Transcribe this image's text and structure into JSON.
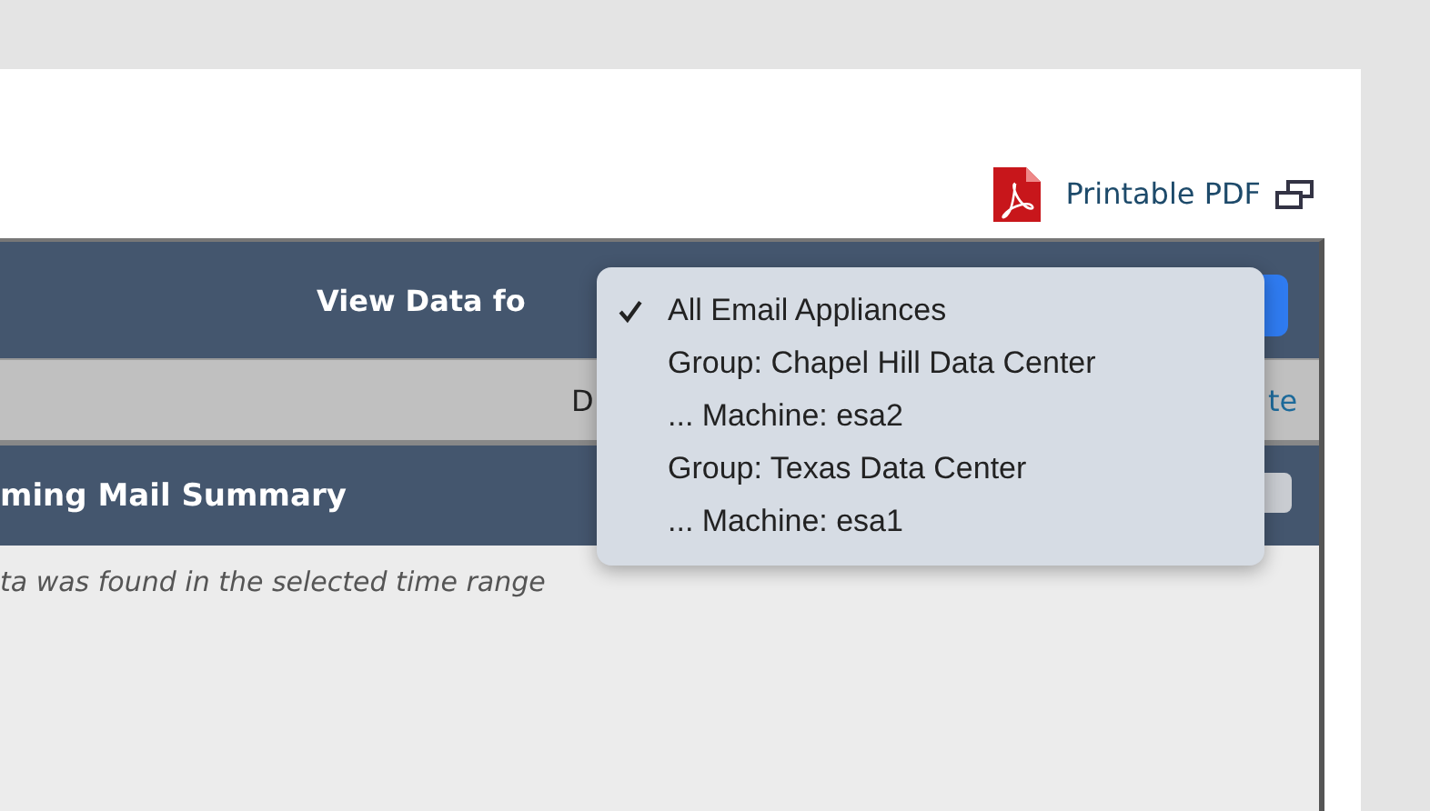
{
  "toolbar": {
    "link": "Printable PDF"
  },
  "panel": {
    "header_label": "View Data fo",
    "filter_bar": {
      "text_1": "D",
      "text_2": "te"
    },
    "section": {
      "title": "ming Mail Summary",
      "message": "ta was found in the selected time range"
    }
  },
  "dropdown": {
    "items": [
      {
        "label": "All Email Appliances",
        "selected": true
      },
      {
        "label": "Group: Chapel Hill Data Center",
        "selected": false
      },
      {
        "label": "... Machine: esa2",
        "selected": false
      },
      {
        "label": "Group: Texas Data Center",
        "selected": false
      },
      {
        "label": "... Machine: esa1",
        "selected": false
      }
    ]
  }
}
